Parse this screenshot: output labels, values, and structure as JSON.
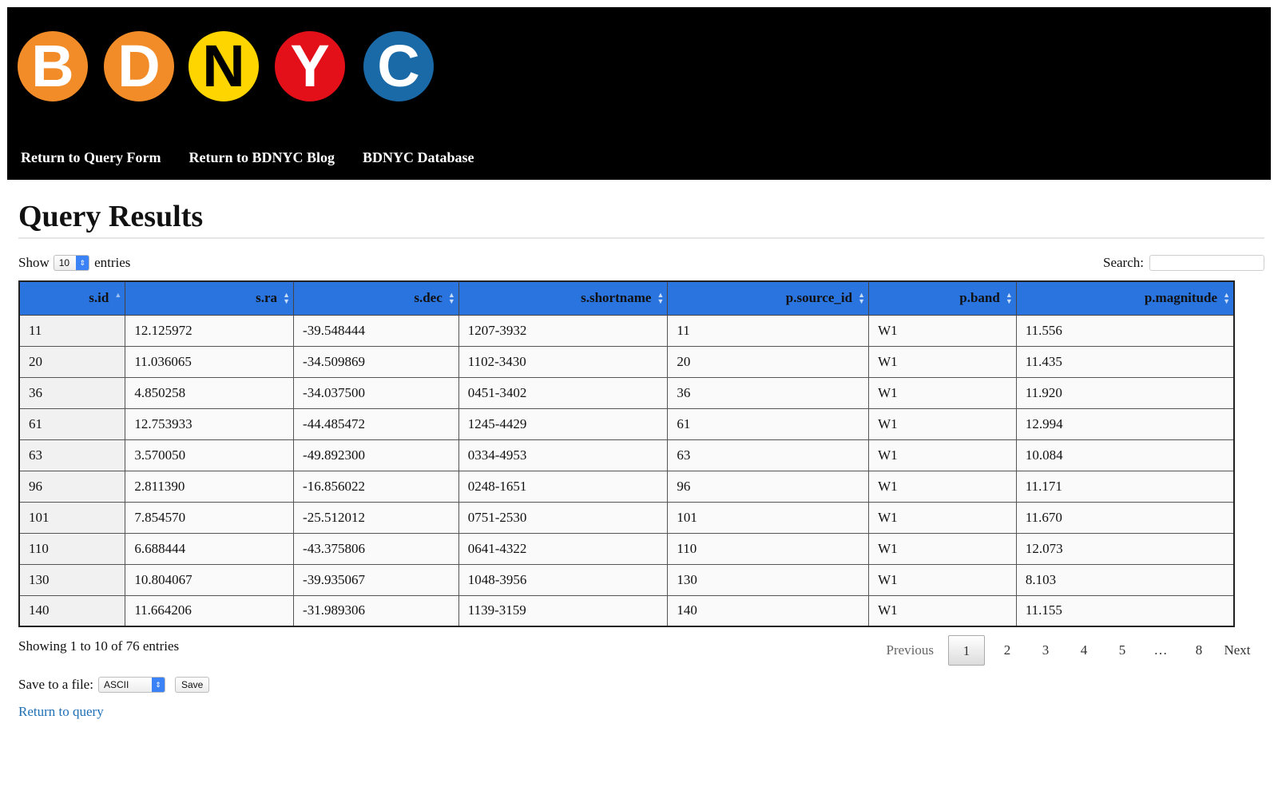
{
  "logo": {
    "letters": [
      {
        "char": "B",
        "bg": "#f28c28",
        "fg": "#ffffff"
      },
      {
        "char": "D",
        "bg": "#f28c28",
        "fg": "#ffffff"
      },
      {
        "char": "N",
        "bg": "#ffd500",
        "fg": "#000000"
      },
      {
        "char": "Y",
        "bg": "#e3101a",
        "fg": "#ffffff"
      },
      {
        "char": "C",
        "bg": "#1a6aa8",
        "fg": "#ffffff"
      }
    ]
  },
  "nav": {
    "items": [
      "Return to Query Form",
      "Return to BDNYC Blog",
      "BDNYC Database"
    ]
  },
  "page": {
    "title": "Query Results"
  },
  "controls": {
    "show_label": "Show",
    "show_value": "10",
    "entries_label": "entries",
    "search_label": "Search:",
    "search_value": ""
  },
  "table": {
    "columns": [
      "s.id",
      "s.ra",
      "s.dec",
      "s.shortname",
      "p.source_id",
      "p.band",
      "p.magnitude"
    ],
    "rows": [
      [
        "11",
        "12.125972",
        "-39.548444",
        "1207-3932",
        "11",
        "W1",
        "11.556"
      ],
      [
        "20",
        "11.036065",
        "-34.509869",
        "1102-3430",
        "20",
        "W1",
        "11.435"
      ],
      [
        "36",
        "4.850258",
        "-34.037500",
        "0451-3402",
        "36",
        "W1",
        "11.920"
      ],
      [
        "61",
        "12.753933",
        "-44.485472",
        "1245-4429",
        "61",
        "W1",
        "12.994"
      ],
      [
        "63",
        "3.570050",
        "-49.892300",
        "0334-4953",
        "63",
        "W1",
        "10.084"
      ],
      [
        "96",
        "2.811390",
        "-16.856022",
        "0248-1651",
        "96",
        "W1",
        "11.171"
      ],
      [
        "101",
        "7.854570",
        "-25.512012",
        "0751-2530",
        "101",
        "W1",
        "11.670"
      ],
      [
        "110",
        "6.688444",
        "-43.375806",
        "0641-4322",
        "110",
        "W1",
        "12.073"
      ],
      [
        "130",
        "10.804067",
        "-39.935067",
        "1048-3956",
        "130",
        "W1",
        "8.103"
      ],
      [
        "140",
        "11.664206",
        "-31.989306",
        "1139-3159",
        "140",
        "W1",
        "11.155"
      ]
    ]
  },
  "footer": {
    "info": "Showing 1 to 10 of 76 entries",
    "pager": {
      "previous": "Previous",
      "pages": [
        "1",
        "2",
        "3",
        "4",
        "5",
        "…",
        "8"
      ],
      "current": "1",
      "next": "Next"
    },
    "save_label": "Save to a file:",
    "save_format": "ASCII",
    "save_button": "Save",
    "return_link": "Return to query"
  },
  "colors": {
    "header_bg": "#000000",
    "table_header_bg": "#2a74e0",
    "link": "#1f6fb5"
  }
}
